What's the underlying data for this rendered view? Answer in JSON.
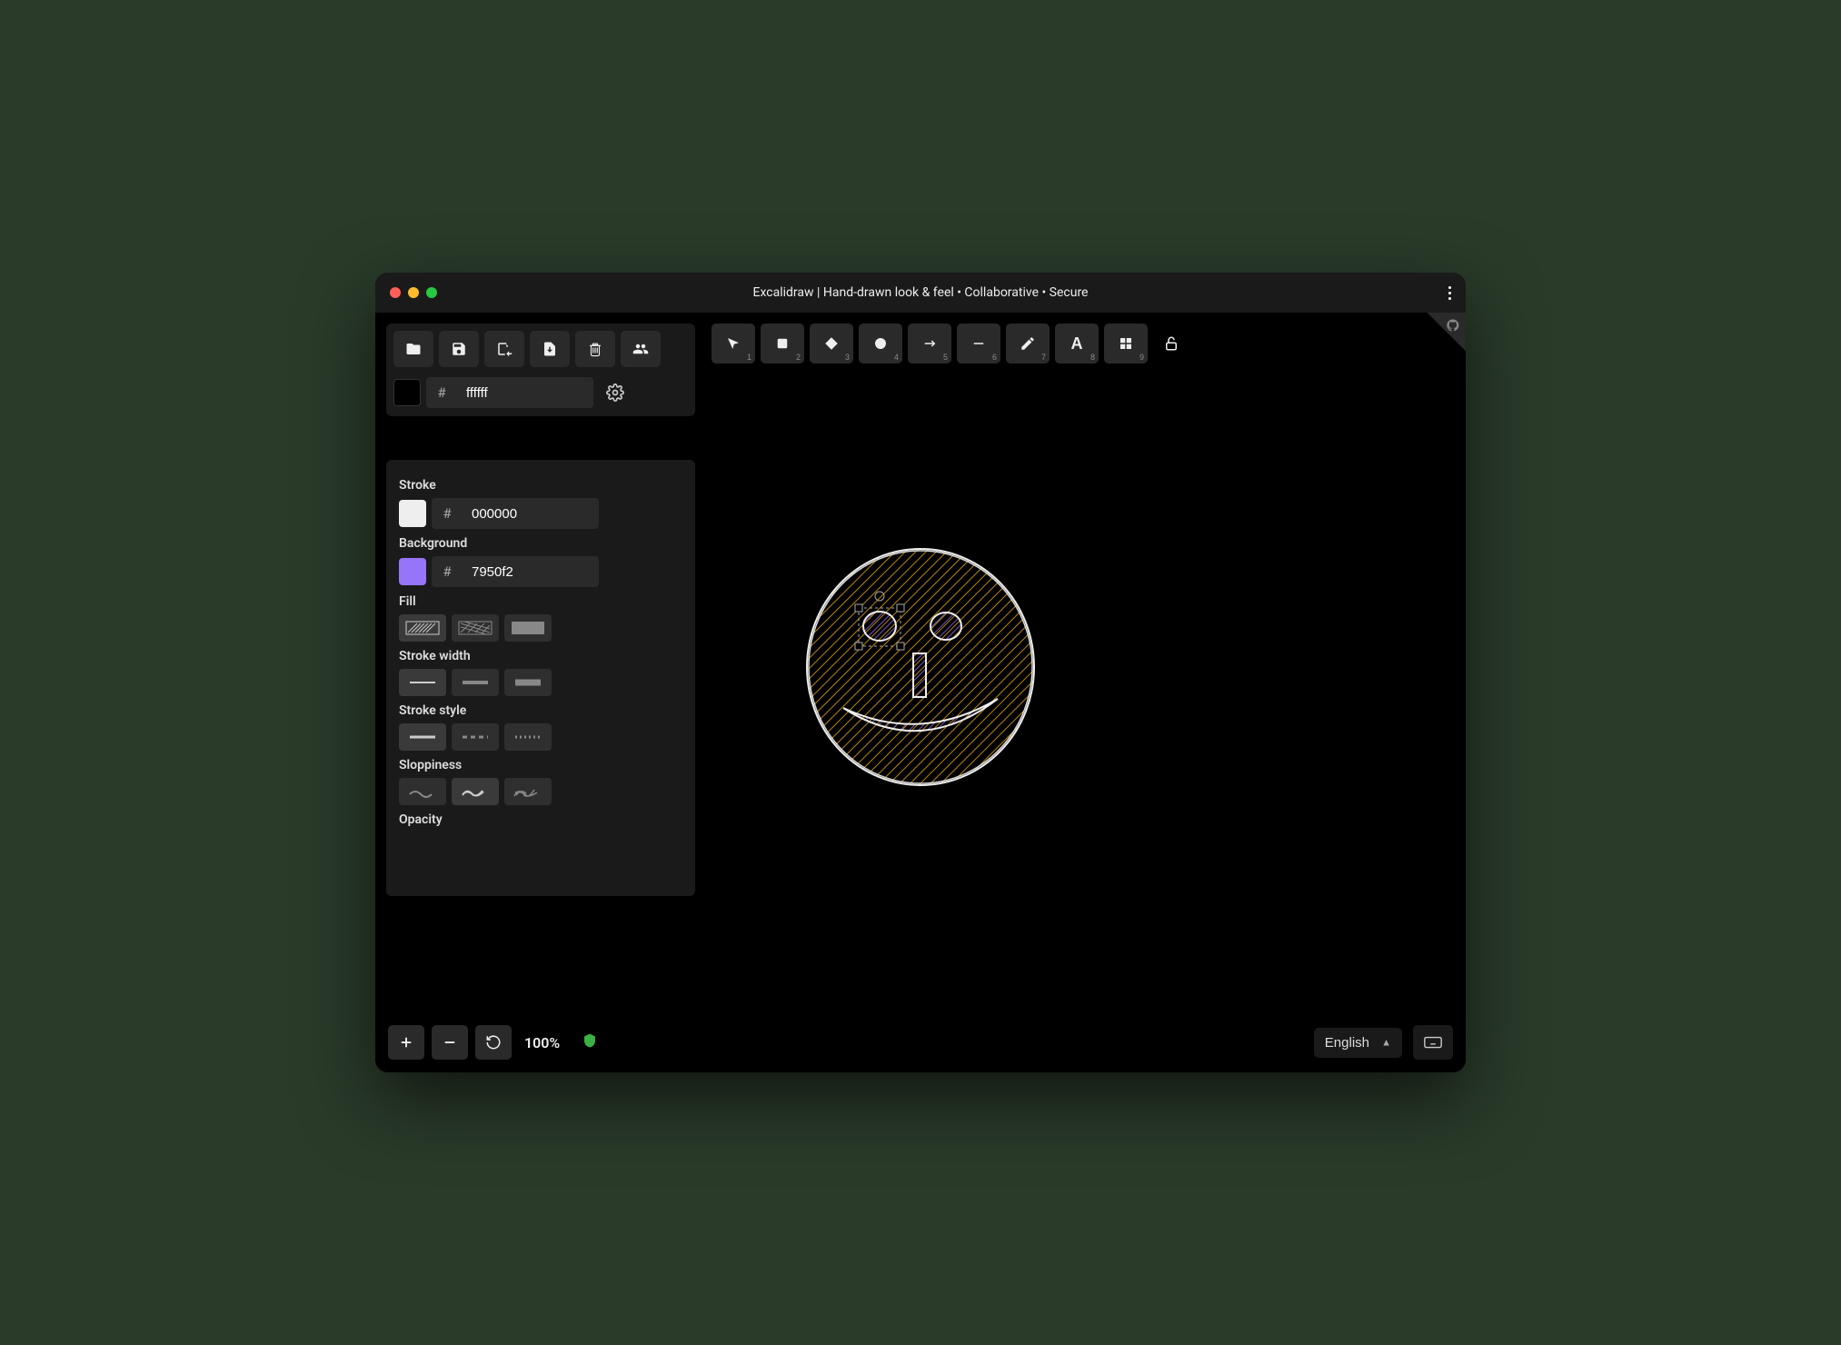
{
  "window": {
    "title": "Excalidraw | Hand-drawn look & feel • Collaborative • Secure"
  },
  "canvas_color": {
    "hash": "#",
    "value": "ffffff"
  },
  "properties": {
    "stroke": {
      "label": "Stroke",
      "hash": "#",
      "value": "000000",
      "swatch_color": "#eeeeee"
    },
    "background": {
      "label": "Background",
      "hash": "#",
      "value": "7950f2",
      "swatch_color": "#9775fa"
    },
    "fill": {
      "label": "Fill"
    },
    "stroke_width": {
      "label": "Stroke width"
    },
    "stroke_style": {
      "label": "Stroke style"
    },
    "sloppiness": {
      "label": "Sloppiness"
    },
    "opacity": {
      "label": "Opacity"
    }
  },
  "tools": {
    "t1": "1",
    "t2": "2",
    "t3": "3",
    "t4": "4",
    "t5": "5",
    "t6": "6",
    "t7": "7",
    "t8": "8",
    "t9": "9"
  },
  "zoom": {
    "value": "100%"
  },
  "language": {
    "value": "English"
  }
}
